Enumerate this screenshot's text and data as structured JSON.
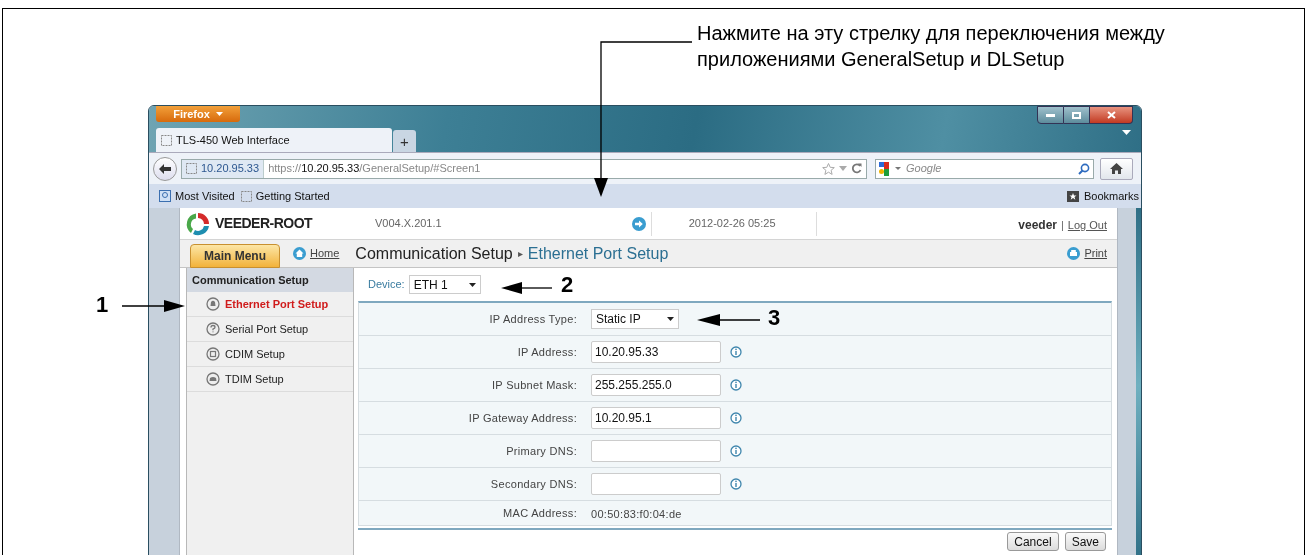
{
  "annotation": {
    "text": "Нажмите на эту стрелку для переключения между приложениями GeneralSetup и DLSetup"
  },
  "callouts": [
    {
      "label": "1"
    },
    {
      "label": "2"
    },
    {
      "label": "3"
    }
  ],
  "browser": {
    "menu_button": "Firefox",
    "tabs": [
      {
        "title": "TLS-450 Web Interface",
        "selected": true
      }
    ],
    "new_tab": "+",
    "identity": "10.20.95.33",
    "url": {
      "scheme": "https://",
      "host": "10.20.95.33",
      "path": "/GeneralSetup/#Screen1"
    },
    "search": {
      "placeholder": "Google"
    },
    "bookmarks": [
      "Most Visited",
      "Getting Started"
    ],
    "bookmarks_menu": "Bookmarks"
  },
  "page": {
    "logo": "VEEDER-ROOT",
    "version": "V004.X.201.1",
    "datetime": "2012-02-26 05:25",
    "user": "veeder",
    "separator": "|",
    "logout": "Log Out",
    "main_menu": "Main Menu",
    "home": "Home",
    "breadcrumb": {
      "parent": "Communication Setup",
      "separator": "▸",
      "current": "Ethernet Port Setup"
    },
    "print": "Print",
    "sidebar": {
      "heading": "Communication Setup",
      "items": [
        {
          "label": "Ethernet Port Setup",
          "selected": true
        },
        {
          "label": "Serial Port Setup",
          "selected": false
        },
        {
          "label": "CDIM Setup",
          "selected": false
        },
        {
          "label": "TDIM Setup",
          "selected": false
        }
      ]
    },
    "device": {
      "label": "Device:",
      "value": "ETH 1"
    },
    "form": [
      {
        "kind": "select",
        "label": "IP Address Type:",
        "value": "Static IP"
      },
      {
        "kind": "input",
        "label": "IP Address:",
        "value": "10.20.95.33"
      },
      {
        "kind": "input",
        "label": "IP Subnet Mask:",
        "value": "255.255.255.0"
      },
      {
        "kind": "input",
        "label": "IP Gateway Address:",
        "value": "10.20.95.1"
      },
      {
        "kind": "input",
        "label": "Primary DNS:"
      },
      {
        "kind": "input",
        "label": "Secondary DNS:"
      },
      {
        "kind": "text",
        "label": "MAC Address:",
        "value": "00:50:83:f0:04:de"
      }
    ],
    "buttons": [
      "Cancel",
      "Save"
    ]
  }
}
